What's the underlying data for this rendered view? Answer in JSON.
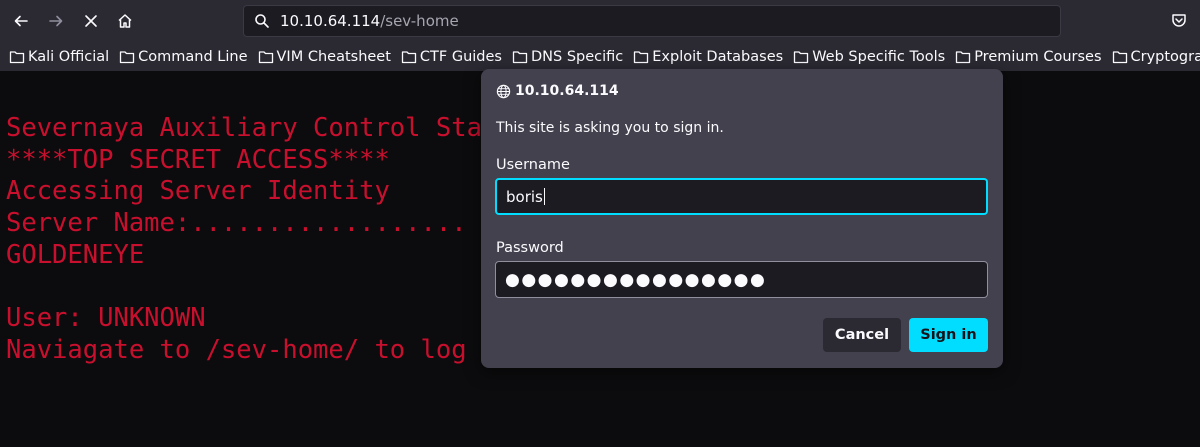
{
  "toolbar": {
    "url_host": "10.10.64.114",
    "url_path": "/sev-home"
  },
  "bookmarks": [
    {
      "label": "Kali Official"
    },
    {
      "label": "Command Line"
    },
    {
      "label": "VIM Cheatsheet"
    },
    {
      "label": "CTF Guides"
    },
    {
      "label": "DNS Specific"
    },
    {
      "label": "Exploit Databases"
    },
    {
      "label": "Web Specific Tools"
    },
    {
      "label": "Premium Courses"
    },
    {
      "label": "Cryptography"
    }
  ],
  "terminal": {
    "lines": [
      "Severnaya Auxiliary Control Sta",
      "****TOP SECRET ACCESS****",
      "Accessing Server Identity",
      "Server Name:..................",
      "GOLDENEYE",
      "",
      "User: UNKNOWN",
      "Naviagate to /sev-home/ to log"
    ]
  },
  "dialog": {
    "host": "10.10.64.114",
    "message": "This site is asking you to sign in.",
    "username_label": "Username",
    "username_value": "boris",
    "password_label": "Password",
    "password_value": "●●●●●●●●●●●●●●●●",
    "cancel_label": "Cancel",
    "signin_label": "Sign in"
  },
  "colors": {
    "terminal_text": "#c8102e",
    "accent": "#00ddff",
    "dialog_bg": "#42414d",
    "toolbar_bg": "#2b2a33"
  }
}
